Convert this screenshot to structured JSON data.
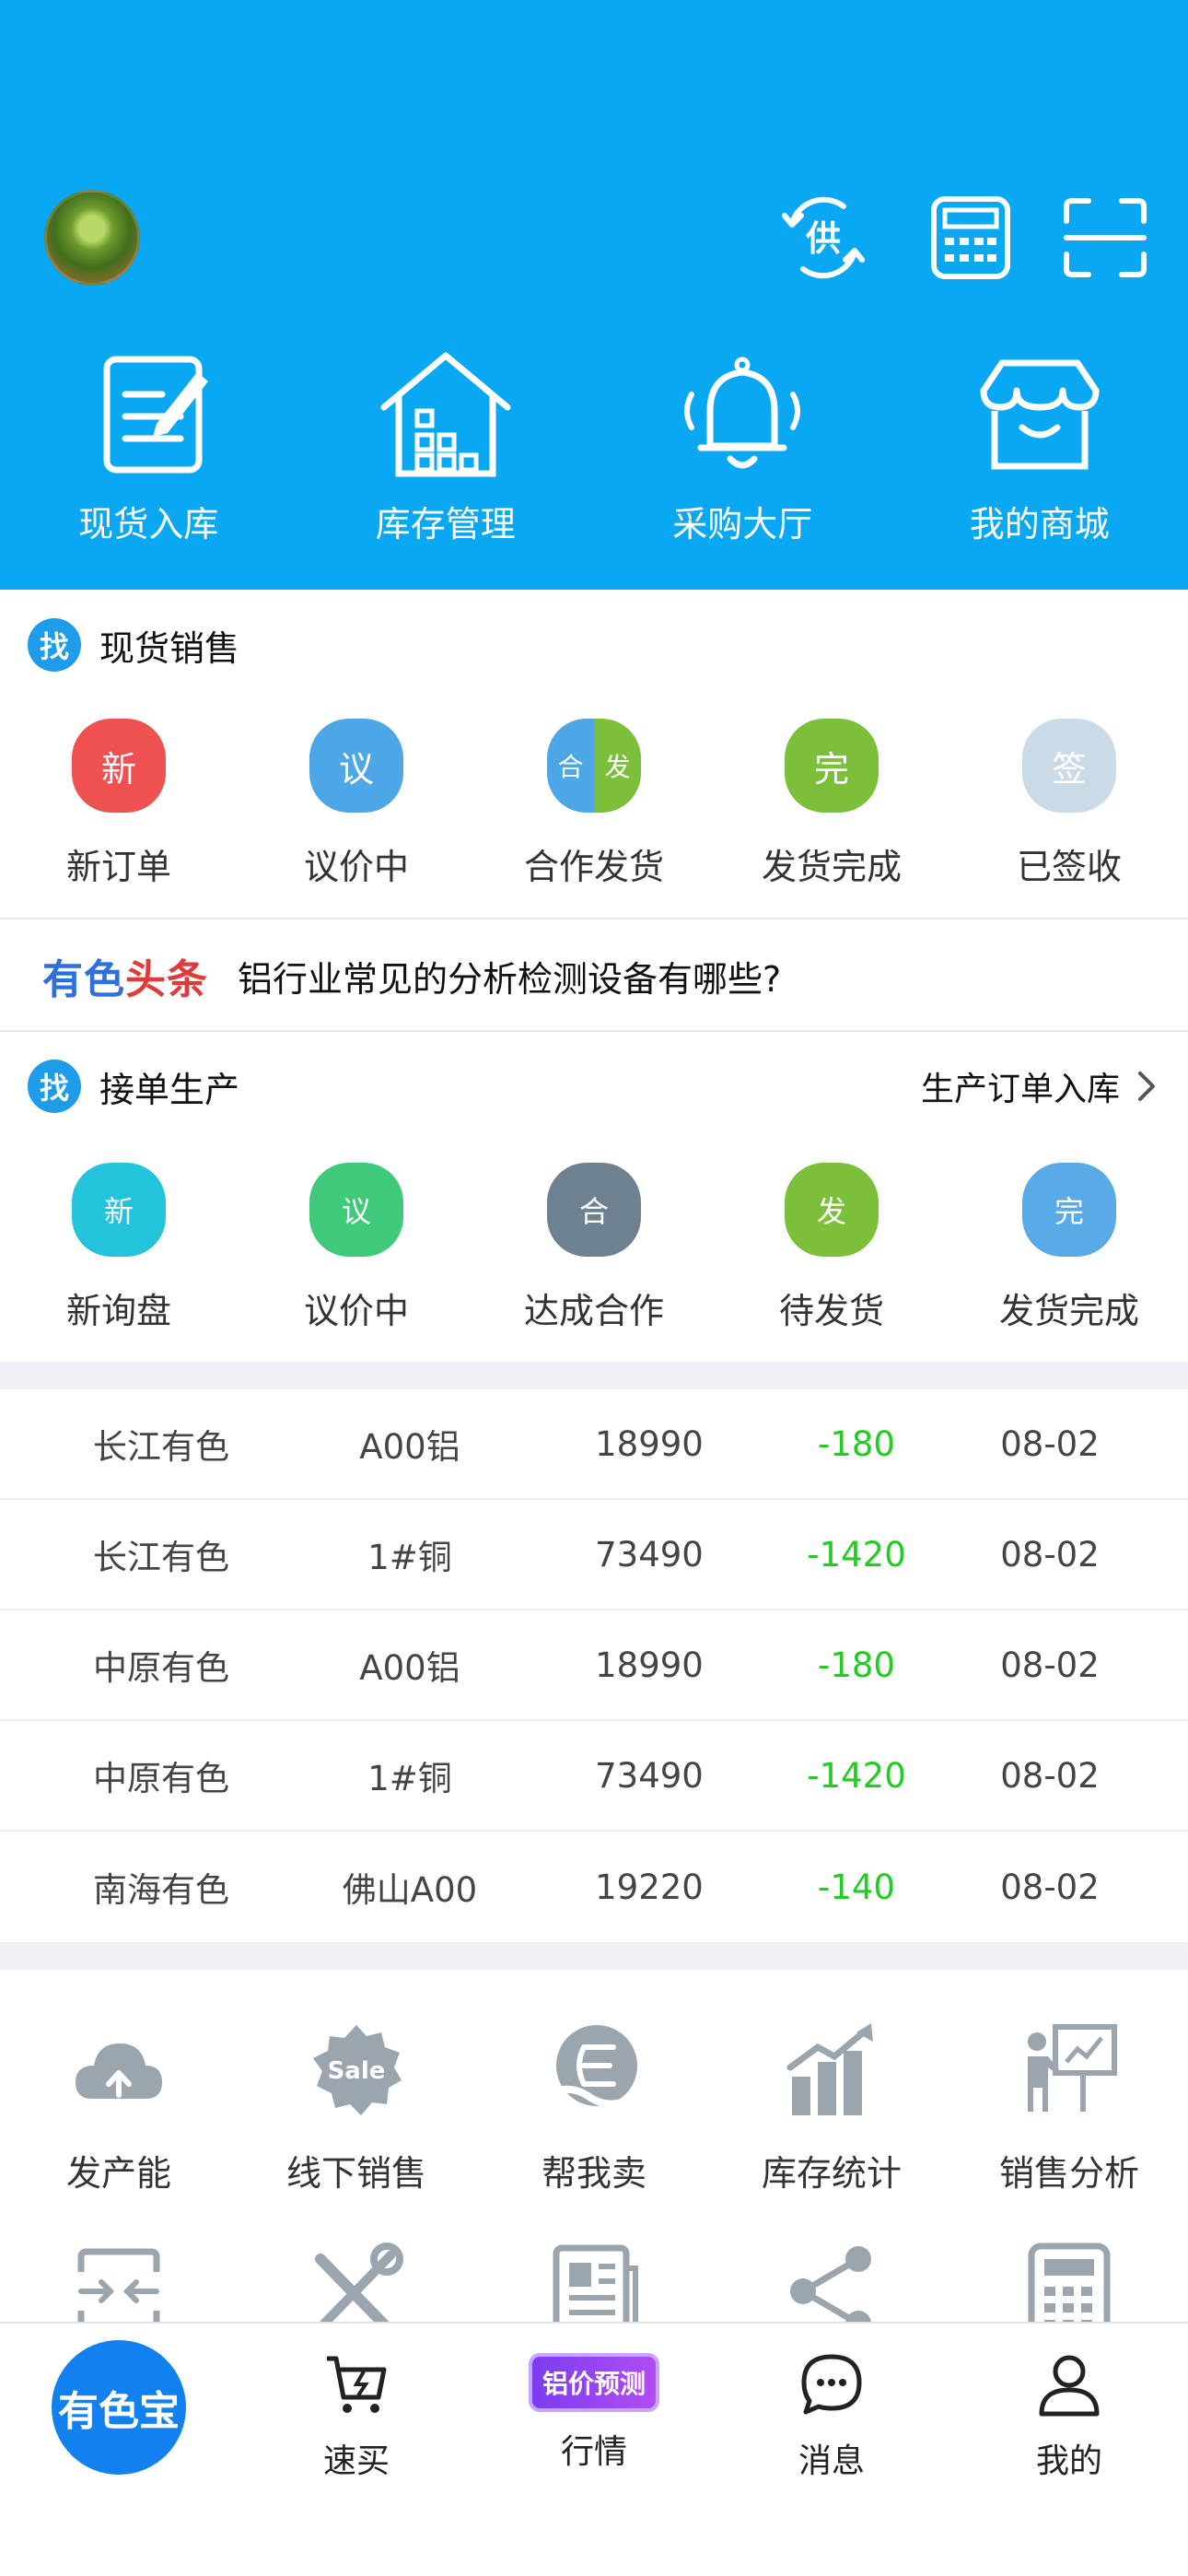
{
  "header": {
    "icons": [
      "supply-exchange-icon",
      "calculator-icon",
      "scan-icon"
    ],
    "supply_icon_char": "供",
    "quick_nav": [
      {
        "label": "现货入库",
        "icon": "document-edit-icon"
      },
      {
        "label": "库存管理",
        "icon": "warehouse-icon"
      },
      {
        "label": "采购大厅",
        "icon": "bell-icon"
      },
      {
        "label": "我的商城",
        "icon": "shop-icon"
      }
    ]
  },
  "spot_sales": {
    "badge": "找",
    "title": "现货销售",
    "items": [
      {
        "glyph": "新",
        "label": "新订单",
        "color": "#ef5050"
      },
      {
        "glyph": "议",
        "label": "议价中",
        "color": "#4da7e6"
      },
      {
        "glyph_left": "合",
        "glyph_right": "发",
        "label": "合作发货",
        "color_left": "#4da7e6",
        "color_right": "#7bbf3a"
      },
      {
        "glyph": "完",
        "label": "发货完成",
        "color": "#7bbf3a"
      },
      {
        "glyph": "签",
        "label": "已签收",
        "color": "#c9dbe6"
      }
    ]
  },
  "news": {
    "brand_a": "有色",
    "brand_b": "头条",
    "headline": "铝行业常见的分析检测设备有哪些?"
  },
  "production": {
    "badge": "找",
    "title": "接单生产",
    "link": "生产订单入库",
    "items": [
      {
        "glyph": "新",
        "label": "新询盘",
        "color": "#22c3db"
      },
      {
        "glyph": "议",
        "label": "议价中",
        "color": "#3fc97a"
      },
      {
        "glyph": "合",
        "label": "达成合作",
        "color": "#6d8191"
      },
      {
        "glyph": "发",
        "label": "待发货",
        "color": "#7bbf3a"
      },
      {
        "glyph": "完",
        "label": "发货完成",
        "color": "#5aaae8"
      }
    ]
  },
  "prices": [
    {
      "market": "长江有色",
      "product": "A00铝",
      "price": "18990",
      "change": "-180",
      "date": "08-02"
    },
    {
      "market": "长江有色",
      "product": "1#铜",
      "price": "73490",
      "change": "-1420",
      "date": "08-02"
    },
    {
      "market": "中原有色",
      "product": "A00铝",
      "price": "18990",
      "change": "-180",
      "date": "08-02"
    },
    {
      "market": "中原有色",
      "product": "1#铜",
      "price": "73490",
      "change": "-1420",
      "date": "08-02"
    },
    {
      "market": "南海有色",
      "product": "佛山A00",
      "price": "19220",
      "change": "-140",
      "date": "08-02"
    }
  ],
  "tools": [
    {
      "label": "发产能",
      "icon": "cloud-upload-icon"
    },
    {
      "label": "线下销售",
      "icon": "sale-badge-icon",
      "icon_text": "Sale"
    },
    {
      "label": "帮我卖",
      "icon": "hand-coin-icon"
    },
    {
      "label": "库存统计",
      "icon": "bar-chart-icon"
    },
    {
      "label": "销售分析",
      "icon": "presentation-icon"
    },
    {
      "label": "",
      "icon": "exchange-icon"
    },
    {
      "label": "",
      "icon": "tools-icon"
    },
    {
      "label": "",
      "icon": "newspaper-icon"
    },
    {
      "label": "",
      "icon": "share-icon"
    },
    {
      "label": "",
      "icon": "calculator-icon"
    }
  ],
  "bottom_nav": {
    "home": "有色宝",
    "items": [
      {
        "label": "速买",
        "icon": "cart-icon"
      },
      {
        "label": "行情",
        "badge": "铝价预测"
      },
      {
        "label": "消息",
        "icon": "chat-icon"
      },
      {
        "label": "我的",
        "icon": "user-icon"
      }
    ]
  },
  "colors": {
    "header_bg": "#0aa7f2",
    "price_change": "#22cc22",
    "tool_icon": "#9aa5ae"
  }
}
